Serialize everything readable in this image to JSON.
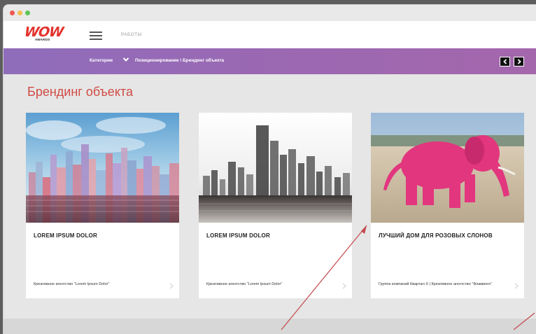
{
  "logo": {
    "word": "WOW",
    "sub": "AWARDS"
  },
  "nav": {
    "link": "РАБОТЫ"
  },
  "catbar": {
    "label": "Категории",
    "breadcrumb": "Позиционирование \\ Брендинг объекта"
  },
  "page": {
    "title": "Брендинг объекта"
  },
  "cards": [
    {
      "title": "LOREM IPSUM DOLOR",
      "agency": "Креативное агентство \"Lorem Ipsum Dolor\""
    },
    {
      "title": "LOREM IPSUM DOLOR",
      "agency": "Креативное агентство \"Lorem Ipsum Dolor\""
    },
    {
      "title": "ЛУЧШИЙ ДОМ ДЛЯ РОЗОВЫХ СЛОНОВ",
      "agency": "Группа компаний Квартал Х | Креативное агентство \"Фламинго\""
    }
  ],
  "colors": {
    "accent": "#d04b45",
    "logo": "#e3322d",
    "catbar_start": "#8f6dbb",
    "catbar_end": "#a467ac",
    "annotation": "#c4474a"
  },
  "icons": {
    "menu": "hamburger-icon",
    "category_toggle": "chevron-down-icon",
    "prev": "chevron-left-icon",
    "next": "chevron-right-icon",
    "card_link": "chevron-right-icon"
  }
}
